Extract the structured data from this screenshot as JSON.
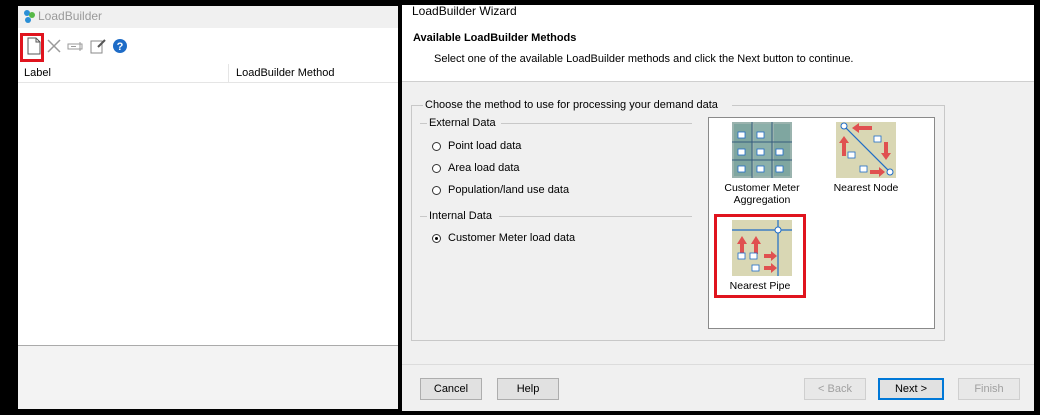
{
  "loadbuilder": {
    "title": "LoadBuilder",
    "toolbar": {
      "icons": [
        "new-icon",
        "delete-icon",
        "rename-icon",
        "edit-icon",
        "help-icon"
      ]
    },
    "columns": [
      "Label",
      "LoadBuilder Method"
    ]
  },
  "wizard": {
    "title": "LoadBuilder Wizard",
    "header": "Available LoadBuilder Methods",
    "instruction": "Select one of the available LoadBuilder methods and click the Next button to continue.",
    "choose_label": "Choose the method to use for processing your demand data",
    "external_group": "External Data",
    "external_options": [
      {
        "label": "Point load data",
        "selected": false
      },
      {
        "label": "Area load data",
        "selected": false
      },
      {
        "label": "Population/land use data",
        "selected": false
      }
    ],
    "internal_group": "Internal Data",
    "internal_options": [
      {
        "label": "Customer Meter load data",
        "selected": true
      }
    ],
    "methods": [
      {
        "line1": "Customer Meter",
        "line2": "Aggregation",
        "selected": false
      },
      {
        "line1": "Nearest Node",
        "line2": "",
        "selected": false
      },
      {
        "line1": "Nearest Pipe",
        "line2": "",
        "selected": true
      }
    ],
    "buttons": {
      "cancel": "Cancel",
      "help": "Help",
      "back": "< Back",
      "next": "Next >",
      "finish": "Finish"
    }
  },
  "colors": {
    "highlight": "#e0141e",
    "accent": "#0078d7",
    "thumb_bg": "#d9d7b4"
  }
}
